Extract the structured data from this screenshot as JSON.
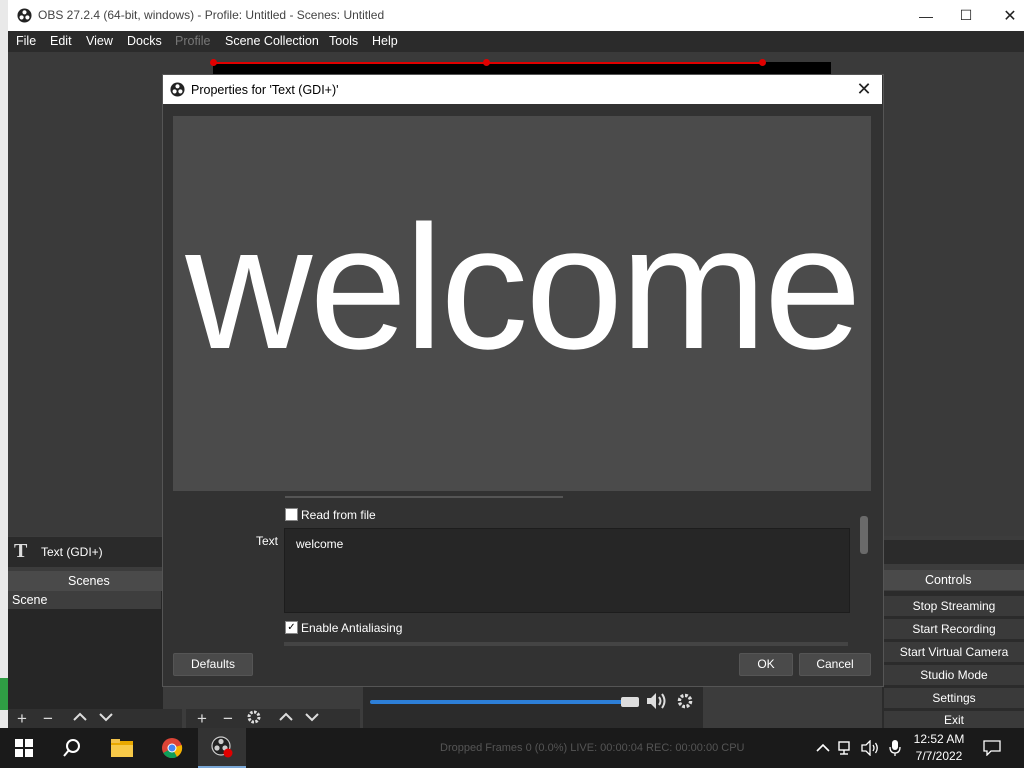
{
  "main_window": {
    "title": "OBS 27.2.4 (64-bit, windows) - Profile: Untitled - Scenes: Untitled",
    "menu": [
      "File",
      "Edit",
      "View",
      "Docks",
      "Profile",
      "Scene Collection",
      "Tools",
      "Help"
    ],
    "menu_disabled": [
      "Profile"
    ]
  },
  "source_bar": {
    "icon": "text-T-icon",
    "label": "Text (GDI+)"
  },
  "scenes": {
    "header": "Scenes",
    "items": [
      "Scene"
    ]
  },
  "controls": {
    "header": "Controls",
    "buttons": [
      "Stop Streaming",
      "Start Recording",
      "Start Virtual Camera",
      "Studio Mode",
      "Settings",
      "Exit"
    ]
  },
  "dialog": {
    "title": "Properties for 'Text (GDI+)'",
    "preview_text": "welcome",
    "read_from_file_label": "Read from file",
    "read_from_file_checked": false,
    "text_label": "Text",
    "text_value": "welcome",
    "antialiasing_label": "Enable Antialiasing",
    "antialiasing_checked": true,
    "defaults_button": "Defaults",
    "ok_button": "OK",
    "cancel_button": "Cancel"
  },
  "status_bar": {
    "text": "Dropped Frames 0 (0.0%)   LIVE: 00:00:04   REC: 00:00:00   CPU"
  },
  "taskbar": {
    "clock_time": "12:52 AM",
    "clock_date": "7/7/2022",
    "apps": [
      "start-icon",
      "search-icon",
      "file-explorer-icon",
      "chrome-icon",
      "obs-icon"
    ]
  },
  "colors": {
    "accent_blue": "#2d7fd8",
    "selection_red": "#e00000"
  }
}
